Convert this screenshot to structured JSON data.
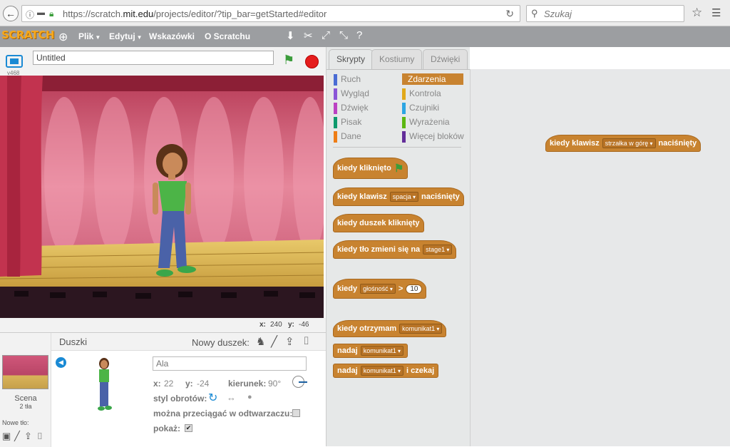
{
  "browser": {
    "url_prefix": "https://scratch.",
    "url_domain": "mit.edu",
    "url_rest": "/projects/editor/?tip_bar=getStarted#editor",
    "search_placeholder": "Szukaj"
  },
  "menubar": {
    "logo": "SCRATCH",
    "items": [
      "Plik",
      "Edytuj",
      "Wskazówki",
      "O Scratchu"
    ]
  },
  "stage": {
    "version": "v468",
    "title": "Untitled",
    "x_label": "x:",
    "x_value": "240",
    "y_label": "y:",
    "y_value": "-46"
  },
  "sprites": {
    "header": "Duszki",
    "new_sprite": "Nowy duszek:",
    "scene_label": "Scena",
    "scene_sub": "2 tła",
    "new_backdrop": "Nowe tło:",
    "sprite_name": "Ala",
    "x_label": "x:",
    "x_value": "22",
    "y_label": "y:",
    "y_value": "-24",
    "direction_label": "kierunek:",
    "direction_value": "90°",
    "rotation_label": "styl obrotów:",
    "drag_label": "można przeciągać w odtwarzaczu:",
    "show_label": "pokaż:",
    "show_checked": "✔"
  },
  "tabs": [
    "Skrypty",
    "Kostiumy",
    "Dźwięki"
  ],
  "categories": {
    "left": [
      {
        "label": "Ruch",
        "color": "#4a6cd4"
      },
      {
        "label": "Wygląd",
        "color": "#8a55d7"
      },
      {
        "label": "Dźwięk",
        "color": "#bb42c3"
      },
      {
        "label": "Pisak",
        "color": "#0e9a6c"
      },
      {
        "label": "Dane",
        "color": "#ee7d16"
      }
    ],
    "right": [
      {
        "label": "Zdarzenia",
        "color": "#c88330"
      },
      {
        "label": "Kontrola",
        "color": "#e1a91a"
      },
      {
        "label": "Czujniki",
        "color": "#2ca5e2"
      },
      {
        "label": "Wyrażenia",
        "color": "#5cb712"
      },
      {
        "label": "Więcej bloków",
        "color": "#632d99"
      }
    ]
  },
  "blocks": {
    "b1": "kiedy kliknięto",
    "b2_a": "kiedy klawisz",
    "b2_drop": "spacja",
    "b2_b": "naciśnięty",
    "b3": "kiedy duszek kliknięty",
    "b4_a": "kiedy tło zmieni się na",
    "b4_drop": "stage1",
    "b5_a": "kiedy",
    "b5_drop": "głośność",
    "b5_op": ">",
    "b5_num": "10",
    "b6_a": "kiedy otrzymam",
    "b6_drop": "komunikat1",
    "b7_a": "nadaj",
    "b7_drop": "komunikat1",
    "b8_a": "nadaj",
    "b8_drop": "komunikat1",
    "b8_b": "i czekaj"
  },
  "script": {
    "a": "kiedy klawisz",
    "drop": "strzałka w górę",
    "b": "naciśnięty"
  }
}
